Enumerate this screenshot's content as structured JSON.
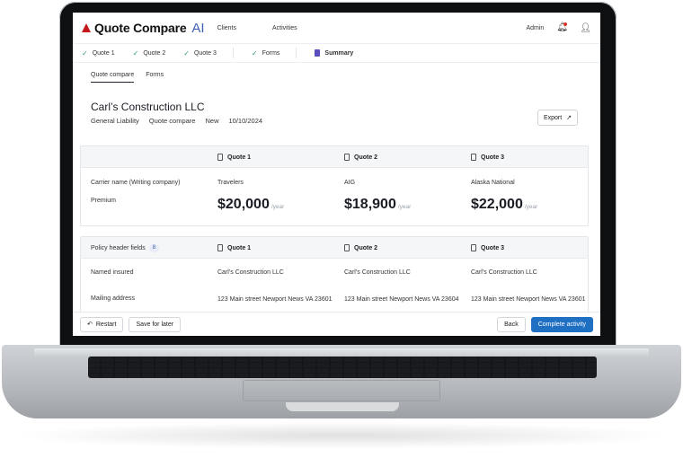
{
  "app": {
    "brand": "Quote Compare",
    "brand_ai": "AI",
    "nav": [
      "Clients",
      "Activities"
    ],
    "user_label": "Admin"
  },
  "steps": [
    {
      "label": "Quote 1",
      "state": "done"
    },
    {
      "label": "Quote 2",
      "state": "done"
    },
    {
      "label": "Quote 3",
      "state": "done"
    },
    {
      "label": "Forms",
      "state": "done"
    },
    {
      "label": "Summary",
      "state": "active"
    }
  ],
  "subtabs": [
    {
      "label": "Quote compare",
      "active": true
    },
    {
      "label": "Forms",
      "active": false
    }
  ],
  "client": {
    "name": "Carl’s Construction LLC",
    "line": "General Liability",
    "type": "Quote compare",
    "status": "New",
    "date": "10/10/2024"
  },
  "export_label": "Export",
  "quotes": [
    "Quote 1",
    "Quote 2",
    "Quote 3"
  ],
  "summary": {
    "carrier_label": "Carrier name (Writing company)",
    "premium_label": "Premium",
    "carriers": [
      "Travelers",
      "AIG",
      "Alaska National"
    ],
    "premiums": [
      "$20,000",
      "$18,900",
      "$22,000"
    ],
    "per": "/year"
  },
  "policy": {
    "section_label": "Policy header fields",
    "count": "8",
    "named_insured_label": "Named insured",
    "named_insured": [
      "Carl’s Construction LLC",
      "Carl’s Construction LLC",
      "Carl’s Construction LLC"
    ],
    "mailing_label": "Mailing address",
    "mailing": [
      "123 Main street Newport News VA 23601",
      "123 Main street Newport News VA 23604",
      "123 Main street Newport News VA 23601"
    ]
  },
  "footer": {
    "restart": "Restart",
    "save": "Save for later",
    "back": "Back",
    "complete": "Complete activity"
  },
  "colors": {
    "brand_red": "#c4161c",
    "ai_blue": "#3f5fb9",
    "check_green": "#2f9d6a",
    "primary": "#1f6fc2"
  }
}
